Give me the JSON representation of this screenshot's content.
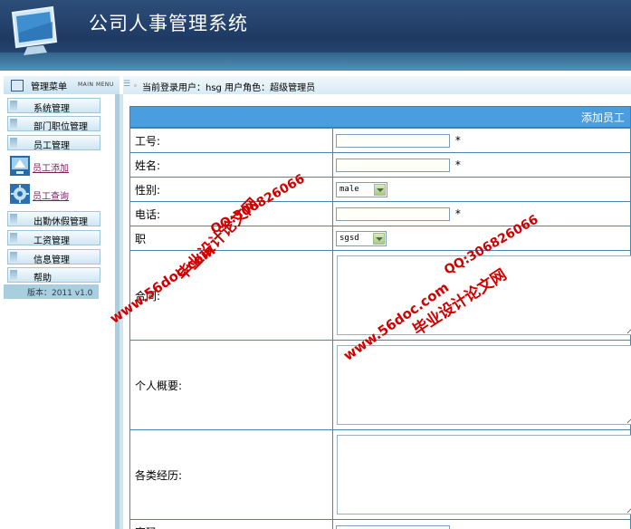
{
  "app": {
    "title": "公司人事管理系统"
  },
  "menu_header": {
    "title": "管理菜单",
    "subtitle": "MAIN MENU"
  },
  "userbar": {
    "text": "当前登录用户：hsg  用户角色：超级管理员"
  },
  "sidebar": {
    "items": [
      {
        "label": "系统管理",
        "icon": "bar-icon"
      },
      {
        "label": "部门职位管理",
        "icon": "bar-icon"
      },
      {
        "label": "员工管理",
        "icon": "bar-icon"
      }
    ],
    "sub_items": [
      {
        "label": "员工添加",
        "icon": "monitor-app-icon"
      },
      {
        "label": "员工查询",
        "icon": "gear-icon"
      }
    ],
    "items2": [
      {
        "label": "出勤休假管理"
      },
      {
        "label": "工资管理"
      },
      {
        "label": "信息管理"
      },
      {
        "label": "帮助"
      }
    ],
    "version": "版本：2011 v1.0"
  },
  "form": {
    "title": "添加员工",
    "fields": [
      {
        "label": "工号:",
        "value": "",
        "required": "*"
      },
      {
        "label": "姓名:",
        "value": "",
        "required": "*"
      },
      {
        "label": "性别:",
        "selected": "male"
      },
      {
        "label": "电话:",
        "value": "",
        "required": "*"
      },
      {
        "label": "职",
        "selected": "sgsd"
      },
      {
        "label": "合同:",
        "value": ""
      },
      {
        "label": "个人概要:",
        "value": ""
      },
      {
        "label": "各类经历:",
        "value": ""
      },
      {
        "label": "密码",
        "value": ""
      }
    ]
  },
  "watermarks": {
    "line1": "毕业设计论文网",
    "line2": "www.56doc.com",
    "line3": "QQ:306826066",
    "color": "#d00000"
  }
}
